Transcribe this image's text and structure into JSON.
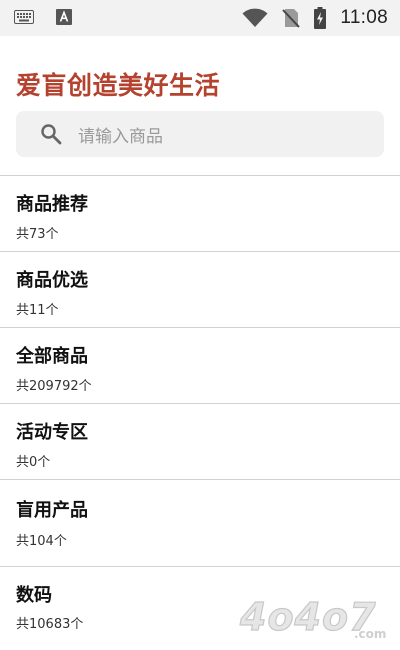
{
  "status_bar": {
    "time": "11:08",
    "icons": [
      "keyboard-icon",
      "text-a-icon",
      "wifi-icon",
      "no-sim-icon",
      "battery-charging-icon"
    ]
  },
  "header": {
    "title": "爱盲创造美好生活"
  },
  "search": {
    "placeholder": "请输入商品"
  },
  "categories": [
    {
      "title": "商品推荐",
      "count": "共73个"
    },
    {
      "title": "商品优选",
      "count": "共11个"
    },
    {
      "title": "全部商品",
      "count": "共209792个"
    },
    {
      "title": "活动专区",
      "count": "共0个"
    },
    {
      "title": "盲用产品",
      "count": "共104个"
    },
    {
      "title": "数码",
      "count": "共10683个"
    }
  ],
  "watermark": {
    "text": "4o4o7",
    "suffix": ".com"
  },
  "colors": {
    "accent": "#b5422e",
    "status_bar_bg": "#f2f2f2",
    "search_bg": "#f1f1f1",
    "divider": "#d2d2d2"
  }
}
